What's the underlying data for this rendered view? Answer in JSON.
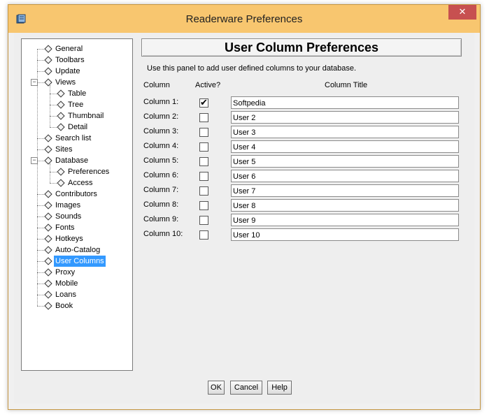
{
  "window": {
    "title": "Readerware Preferences",
    "close_symbol": "✕",
    "app_icon": "readerware-app-icon",
    "title_bar_color": "#f8c66f",
    "close_color": "#c75050"
  },
  "tree": {
    "items": [
      {
        "label": "General",
        "level": 0,
        "expandable": false
      },
      {
        "label": "Toolbars",
        "level": 0,
        "expandable": false
      },
      {
        "label": "Update",
        "level": 0,
        "expandable": false
      },
      {
        "label": "Views",
        "level": 0,
        "expandable": true,
        "expanded": true
      },
      {
        "label": "Table",
        "level": 1,
        "expandable": false
      },
      {
        "label": "Tree",
        "level": 1,
        "expandable": false
      },
      {
        "label": "Thumbnail",
        "level": 1,
        "expandable": false
      },
      {
        "label": "Detail",
        "level": 1,
        "expandable": false
      },
      {
        "label": "Search list",
        "level": 0,
        "expandable": false
      },
      {
        "label": "Sites",
        "level": 0,
        "expandable": false
      },
      {
        "label": "Database",
        "level": 0,
        "expandable": true,
        "expanded": true
      },
      {
        "label": "Preferences",
        "level": 1,
        "expandable": false
      },
      {
        "label": "Access",
        "level": 1,
        "expandable": false
      },
      {
        "label": "Contributors",
        "level": 0,
        "expandable": false
      },
      {
        "label": "Images",
        "level": 0,
        "expandable": false
      },
      {
        "label": "Sounds",
        "level": 0,
        "expandable": false
      },
      {
        "label": "Fonts",
        "level": 0,
        "expandable": false
      },
      {
        "label": "Hotkeys",
        "level": 0,
        "expandable": false
      },
      {
        "label": "Auto-Catalog",
        "level": 0,
        "expandable": false
      },
      {
        "label": "User Columns",
        "level": 0,
        "expandable": false,
        "selected": true
      },
      {
        "label": "Proxy",
        "level": 0,
        "expandable": false
      },
      {
        "label": "Mobile",
        "level": 0,
        "expandable": false
      },
      {
        "label": "Loans",
        "level": 0,
        "expandable": false
      },
      {
        "label": "Book",
        "level": 0,
        "expandable": false
      }
    ]
  },
  "panel": {
    "header": "User Column Preferences",
    "intro": "Use this panel to add user defined columns to your database.",
    "col_column": "Column",
    "col_active": "Active?",
    "col_title": "Column Title",
    "rows": [
      {
        "label": "Column 1:",
        "active": true,
        "title": "Softpedia"
      },
      {
        "label": "Column 2:",
        "active": false,
        "title": "User 2"
      },
      {
        "label": "Column 3:",
        "active": false,
        "title": "User 3"
      },
      {
        "label": "Column 4:",
        "active": false,
        "title": "User 4"
      },
      {
        "label": "Column 5:",
        "active": false,
        "title": "User 5"
      },
      {
        "label": "Column 6:",
        "active": false,
        "title": "User 6"
      },
      {
        "label": "Column 7:",
        "active": false,
        "title": "User 7"
      },
      {
        "label": "Column 8:",
        "active": false,
        "title": "User 8"
      },
      {
        "label": "Column 9:",
        "active": false,
        "title": "User 9"
      },
      {
        "label": "Column 10:",
        "active": false,
        "title": "User 10"
      }
    ],
    "check_glyph": "✔"
  },
  "buttons": {
    "ok": "OK",
    "cancel": "Cancel",
    "help": "Help"
  }
}
